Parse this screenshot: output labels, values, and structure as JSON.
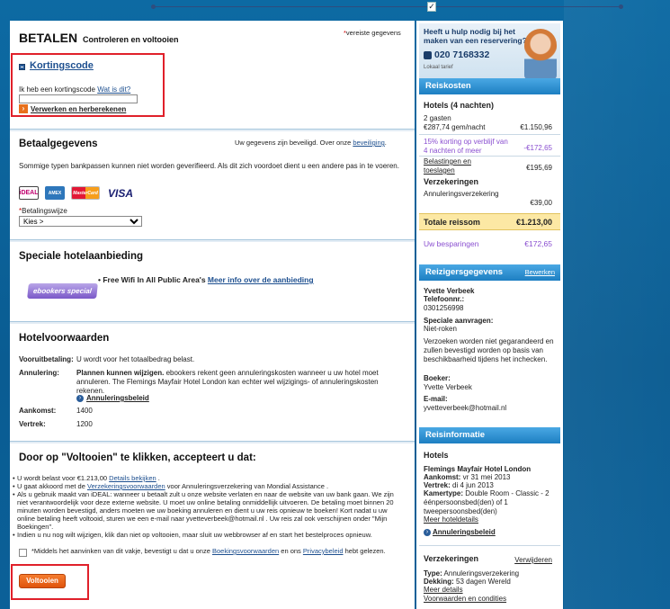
{
  "header": {
    "title": "BETALEN",
    "subtitle": "Controleren en voltooien",
    "required_note": "vereiste gegevens",
    "required_star": "*"
  },
  "discount": {
    "title": "Kortingscode",
    "question": "Ik heb een kortingscode",
    "what_link": "Wat is dit?",
    "input_value": "",
    "apply_link": "Verwerken en herberekenen"
  },
  "payment": {
    "title": "Betaalgegevens",
    "secure_text": "Uw gegevens zijn beveiligd. Over onze",
    "secure_link": "beveiliging",
    "note": "Sommige typen bankpassen kunnen niet worden geverifieerd. Als dit zich voordoet dient u een andere pas in te voeren.",
    "cards": [
      "iDEAL",
      "AMEX",
      "MasterCard",
      "VISA"
    ],
    "method_label": "Betalingswijze",
    "method_star": "*",
    "method_selected": "Kies >"
  },
  "special": {
    "title": "Speciale hotelaanbieding",
    "badge": "ebookers special",
    "offer": "Free Wifi In All Public Area's",
    "offer_link": "Meer info over de aanbieding"
  },
  "conditions": {
    "title": "Hotelvoorwaarden",
    "prepay_label": "Vooruitbetaling:",
    "prepay_value": "U wordt voor het totaalbedrag belast.",
    "cancel_label": "Annulering:",
    "cancel_bold": "Plannen kunnen wijzigen.",
    "cancel_text": "ebookers rekent geen annuleringskosten wanneer u uw hotel moet annuleren. The Flemings Mayfair Hotel London kan echter wel wijzigings- of annuleringskosten rekenen.",
    "cancel_link": "Annuleringsbeleid",
    "arrival_label": "Aankomst:",
    "arrival_value": "1400",
    "departure_label": "Vertrek:",
    "departure_value": "1200"
  },
  "accept": {
    "title": "Door op \"Voltooien\" te klikken, accepteert u dat:",
    "b1_text": "U wordt belast voor €1.213,00",
    "b1_link": "Details bekijken",
    "b2_pre": "U gaat akkoord met de",
    "b2_link": "Verzekeringsvoorwaarden",
    "b2_post": "voor Annuleringsverzekering van Mondial Assistance .",
    "b3": "Als u gebruik maakt van iDEAL: wanneer u betaalt zult u onze website verlaten en naar de website van uw bank gaan. We zijn niet verantwoordelijk voor deze externe website. U moet uw online betaling onmiddellijk uitvoeren. De betaling moet binnen 20 minuten worden bevestigd, anders moeten we uw boeking annuleren en dient u uw reis opnieuw te boeken! Kort nadat u uw online betaling heeft voltooid, sturen we een e-mail naar yvetteverbeek@hotmail.nl . Uw reis zal ook verschijnen onder \"Mijn Boekingen\".",
    "b4": "Indien u nu nog wilt wijzigen, klik dan niet op voltooien, maar sluit uw webbrowser af en start het bestelproces opnieuw.",
    "check_pre": "*Middels het aanvinken van dit vakje, bevestigt u dat u onze",
    "check_link1": "Boekingsvoorwaarden",
    "check_mid": "en ons",
    "check_link2": "Privacybeleid",
    "check_post": "hebt gelezen.",
    "button": "Voltooien"
  },
  "help": {
    "title": "Heeft u hulp nodig bij het maken van een reservering?",
    "phone": "020 7168332",
    "rate": "Lokaal tarief"
  },
  "costs": {
    "head": "Reiskosten",
    "hotels_label": "Hotels (4 nachten)",
    "guests": "2 gasten",
    "per_night": "€287,74 gem/nacht",
    "hotel_total": "€1.150,96",
    "discount_label": "15% korting op verblijf van 4 nachten of meer",
    "discount_value": "-€172,65",
    "taxes_link": "Belastingen en toeslagen",
    "taxes_value": "€195,69",
    "insurance_label": "Verzekeringen",
    "insurance_item": "Annuleringsverzekering",
    "insurance_value": "€39,00",
    "total_label": "Totale reissom",
    "total_value": "€1.213,00",
    "savings_label": "Uw besparingen",
    "savings_value": "€172,65"
  },
  "traveler": {
    "head": "Reizigersgegevens",
    "edit": "Bewerken",
    "name": "Yvette Verbeek",
    "phone_label": "Telefoonnr.:",
    "phone": "0301256998",
    "requests_label": "Speciale aanvragen:",
    "requests": "Niet-roken",
    "requests_note": "Verzoeken worden niet gegarandeerd en zullen bevestigd worden op basis van beschikbaarheid tijdens het inchecken.",
    "booker_label": "Boeker:",
    "booker": "Yvette Verbeek",
    "email_label": "E-mail:",
    "email": "yvetteverbeek@hotmail.nl"
  },
  "travelinfo": {
    "head": "Reisinformatie",
    "hotels_label": "Hotels",
    "hotel_name": "Flemings Mayfair Hotel London",
    "arrival_label": "Aankomst:",
    "arrival": "vr 31 mei 2013",
    "departure_label": "Vertrek:",
    "departure": "di 4 jun 2013",
    "room_label": "Kamertype:",
    "room": "Double Room - Classic - 2 éénpersoonsbed(den) of 1 tweepersoonsbed(den)",
    "more_link": "Meer hoteldetails",
    "cancel_link": "Annuleringsbeleid",
    "ins_label": "Verzekeringen",
    "ins_remove": "Verwijderen",
    "ins_type_label": "Type:",
    "ins_type": "Annuleringsverzekering",
    "ins_cover_label": "Dekking:",
    "ins_cover": "53 dagen Wereld",
    "ins_more": "Meer details",
    "ins_terms": "Voorwaarden en condities"
  }
}
